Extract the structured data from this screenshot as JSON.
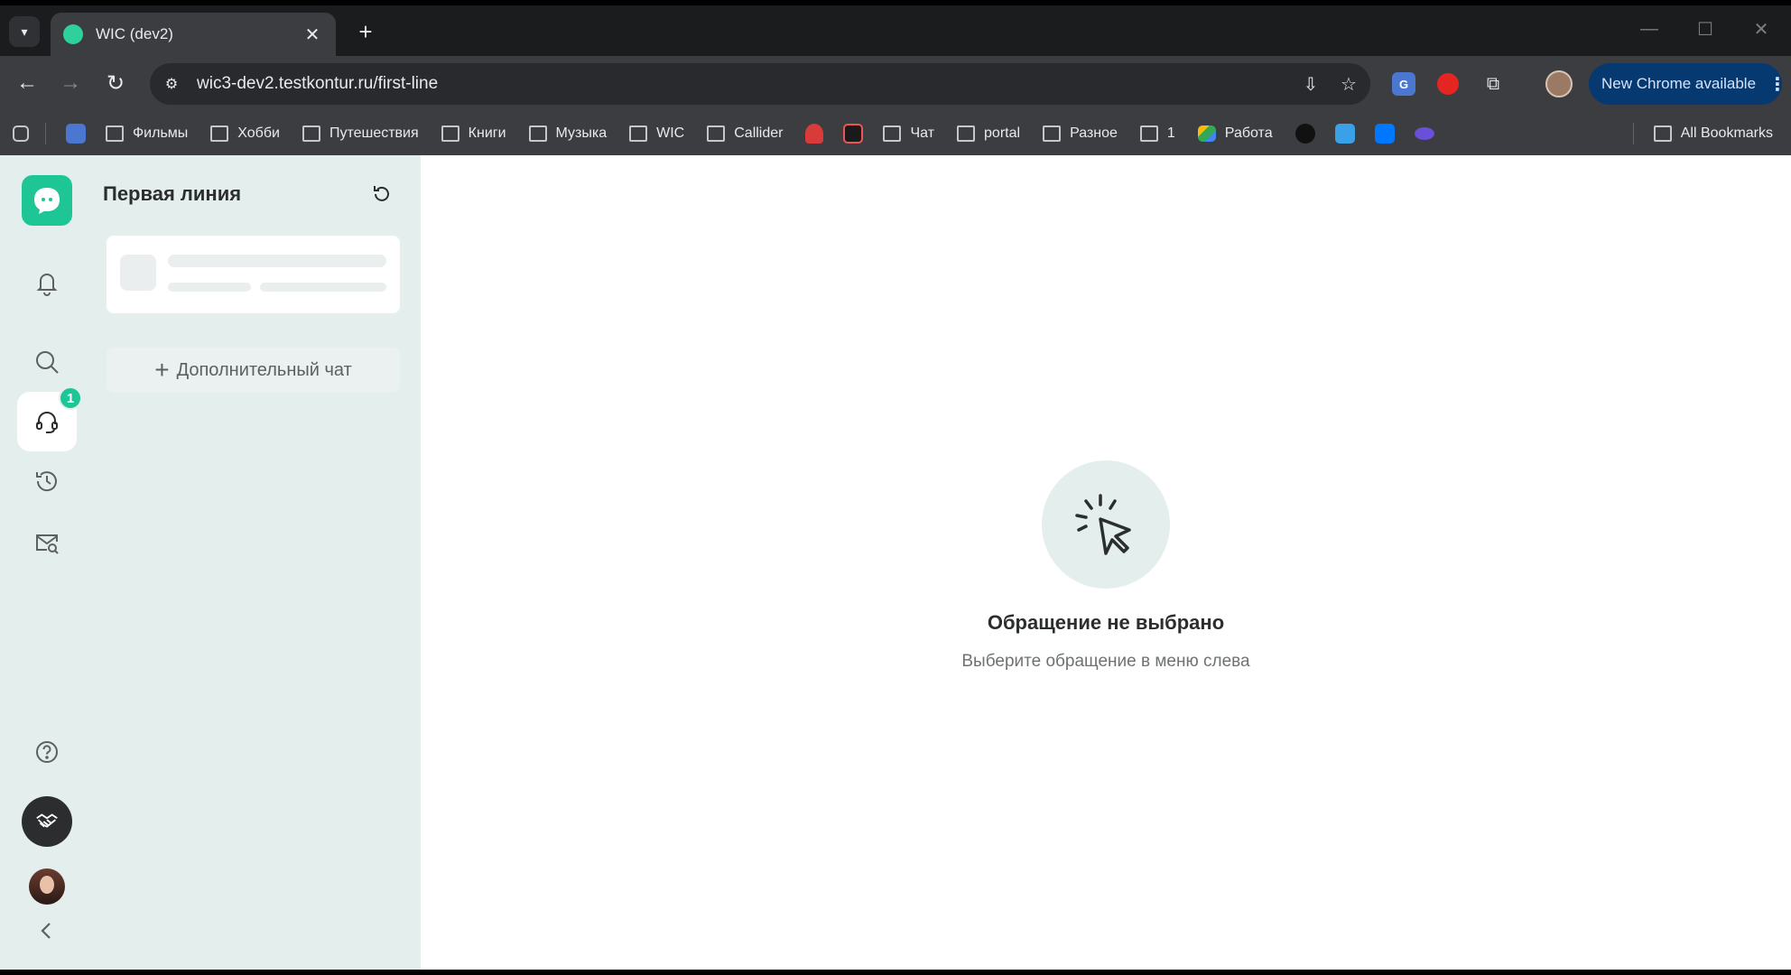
{
  "browser": {
    "tab_title": "WIC (dev2)",
    "url": "wic3-dev2.testkontur.ru/first-line",
    "update_label": "New Chrome available",
    "bookmarks": [
      "Фильмы",
      "Хобби",
      "Путешествия",
      "Книги",
      "Музыка",
      "WIC",
      "Callider",
      "Чат",
      "portal",
      "Разное",
      "1",
      "Работа"
    ],
    "all_bookmarks": "All Bookmarks"
  },
  "rail": {
    "badge_count": "1",
    "accent_color": "#1ec695"
  },
  "panel": {
    "title": "Первая линия",
    "add_chat_label": "Дополнительный чат"
  },
  "main": {
    "empty_title": "Обращение не выбрано",
    "empty_subtitle": "Выберите обращение в меню слева"
  }
}
